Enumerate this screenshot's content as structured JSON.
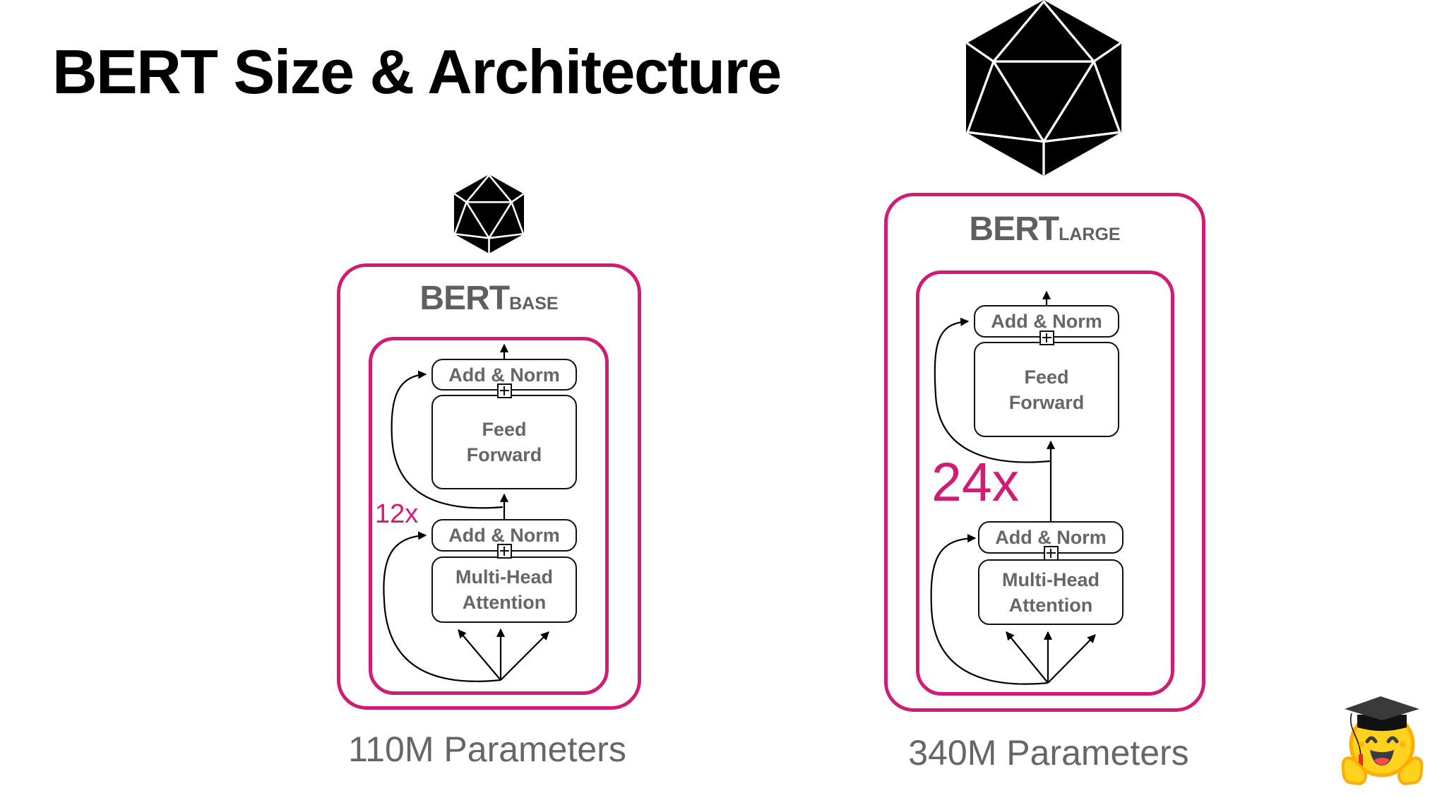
{
  "title": "BERT Size & Architecture",
  "colors": {
    "accent": "#d01c75",
    "text_gray": "#666666",
    "label_gray": "#5f5f5f"
  },
  "models": [
    {
      "id": "base",
      "name_main": "BERT",
      "name_sub": "BASE",
      "repeat_label": "12x",
      "params_label": "110M Parameters",
      "icon": "icosahedron-icon",
      "blocks": {
        "add_norm_top": "Add & Norm",
        "feed_forward_line1": "Feed",
        "feed_forward_line2": "Forward",
        "add_norm_bottom": "Add & Norm",
        "attention_line1": "Multi-Head",
        "attention_line2": "Attention"
      }
    },
    {
      "id": "large",
      "name_main": "BERT",
      "name_sub": "LARGE",
      "repeat_label": "24x",
      "params_label": "340M Parameters",
      "icon": "icosahedron-icon",
      "blocks": {
        "add_norm_top": "Add & Norm",
        "feed_forward_line1": "Feed",
        "feed_forward_line2": "Forward",
        "add_norm_bottom": "Add & Norm",
        "attention_line1": "Multi-Head",
        "attention_line2": "Attention"
      }
    }
  ],
  "mascot": "hugging-face-graduate-icon"
}
